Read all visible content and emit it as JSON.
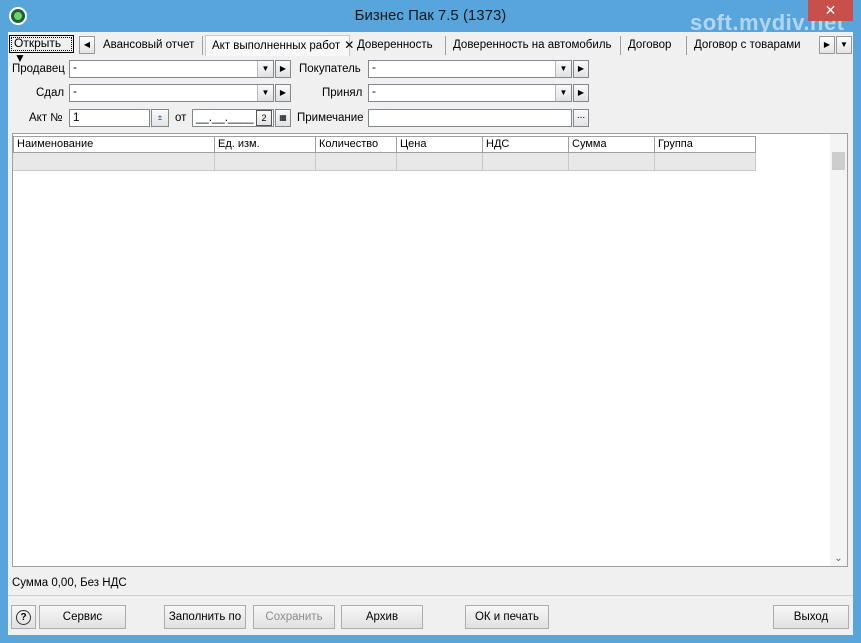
{
  "window": {
    "title": "Бизнес Пак 7.5 (1373)",
    "watermark": "soft.mydiv.net",
    "close_glyph": "✕"
  },
  "tabs": {
    "open_label": "Открыть",
    "items": [
      {
        "label": "Авансовый отчет"
      },
      {
        "label": "Акт выполненных работ",
        "active": true
      },
      {
        "label": "Доверенность"
      },
      {
        "label": "Доверенность на автомобиль"
      },
      {
        "label": "Договор"
      },
      {
        "label": "Договор с товарами"
      }
    ]
  },
  "form": {
    "seller_label": "Продавец",
    "seller_value": "-",
    "buyer_label": "Покупатель",
    "buyer_value": "-",
    "handed_label": "Сдал",
    "handed_value": "-",
    "received_label": "Принял",
    "received_value": "-",
    "act_label": "Акт №",
    "act_value": "1",
    "date_label": "от",
    "date_value": "__.__.____",
    "note_label": "Примечание",
    "note_value": "",
    "ellipsis": "..."
  },
  "table": {
    "columns": [
      "Наименование",
      "Ед. изм.",
      "Количество",
      "Цена",
      "НДС",
      "Сумма",
      "Группа"
    ]
  },
  "status": {
    "text": "Сумма 0,00, Без НДС"
  },
  "buttons": {
    "help": "?",
    "service": "Сервис",
    "fill": "Заполнить по",
    "save": "Сохранить",
    "archive": "Архив",
    "ok_print": "ОК и печать",
    "exit": "Выход"
  }
}
